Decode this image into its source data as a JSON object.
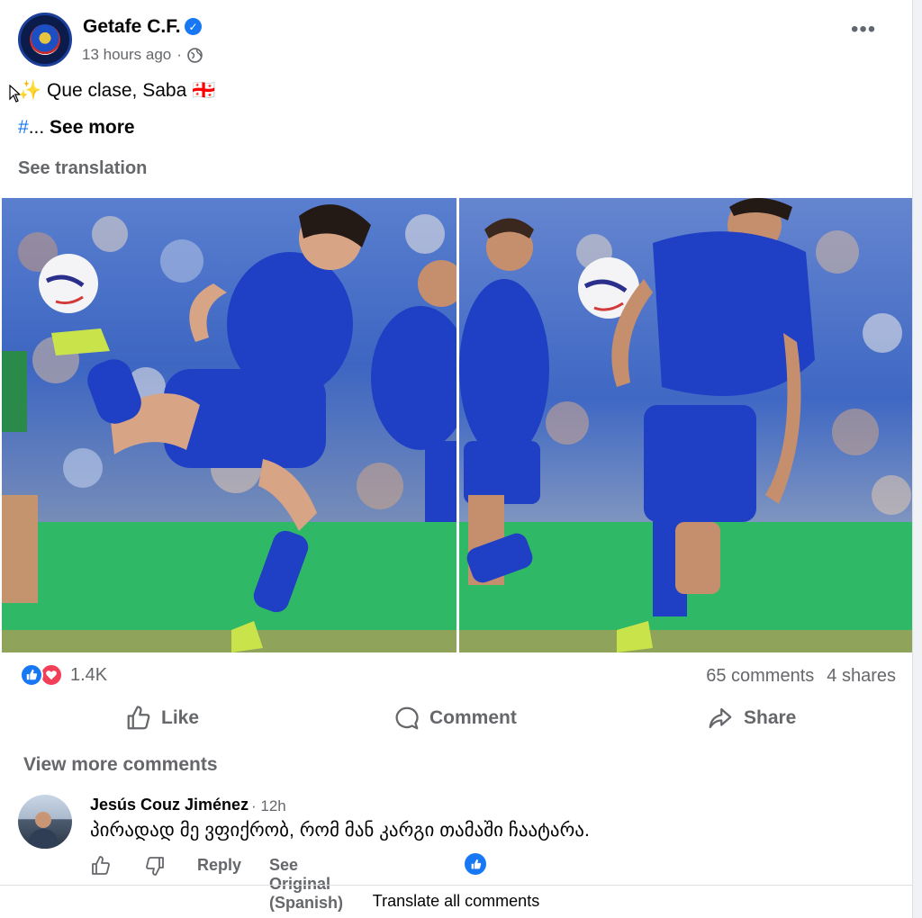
{
  "post": {
    "page_name": "Getafe C.F.",
    "timestamp": "13 hours ago",
    "separator": "·",
    "line1": "✨ Que clase, Saba 🇬🇪",
    "line2_hash": "#",
    "line2_rest": "...",
    "see_more": "See more",
    "see_translation": "See translation"
  },
  "stats": {
    "reaction_count": "1.4K",
    "comments": "65 comments",
    "shares": "4 shares"
  },
  "actions": {
    "like": "Like",
    "comment": "Comment",
    "share": "Share"
  },
  "comments_section": {
    "view_more": "View more comments",
    "items": [
      {
        "author": "Jesús Couz Jiménez",
        "time": "· 12h",
        "text": "პირადად მე ვფიქრობ, რომ მან კარგი თამაში ჩაატარა.",
        "reply": "Reply",
        "see_original": "See Original (Spanish)"
      }
    ],
    "translate_all": "Translate all comments"
  },
  "colors": {
    "brand_blue": "#1877f2",
    "love_red": "#f33e58",
    "kit_blue": "#1f3fc4",
    "pitch_green": "#2fb866"
  },
  "icons": [
    "verified-icon",
    "globe-icon",
    "more-icon",
    "like-icon",
    "comment-icon",
    "share-icon",
    "thumbs-up-icon",
    "thumbs-down-icon",
    "heart-icon"
  ]
}
